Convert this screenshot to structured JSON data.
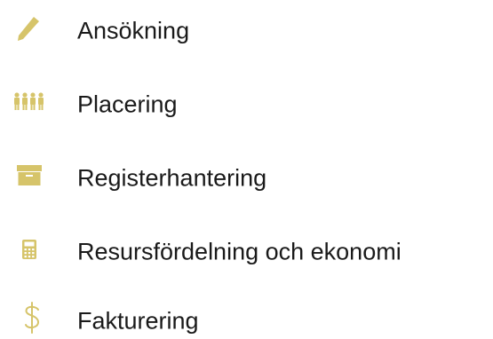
{
  "accent_color": "#d6c46a",
  "menu": {
    "items": [
      {
        "label": "Ansökning",
        "icon": "pencil-icon"
      },
      {
        "label": "Placering",
        "icon": "people-group-icon"
      },
      {
        "label": "Registerhantering",
        "icon": "archive-box-icon"
      },
      {
        "label": "Resursfördelning och ekonomi",
        "icon": "calculator-icon"
      },
      {
        "label": "Fakturering",
        "icon": "dollar-icon"
      }
    ]
  }
}
